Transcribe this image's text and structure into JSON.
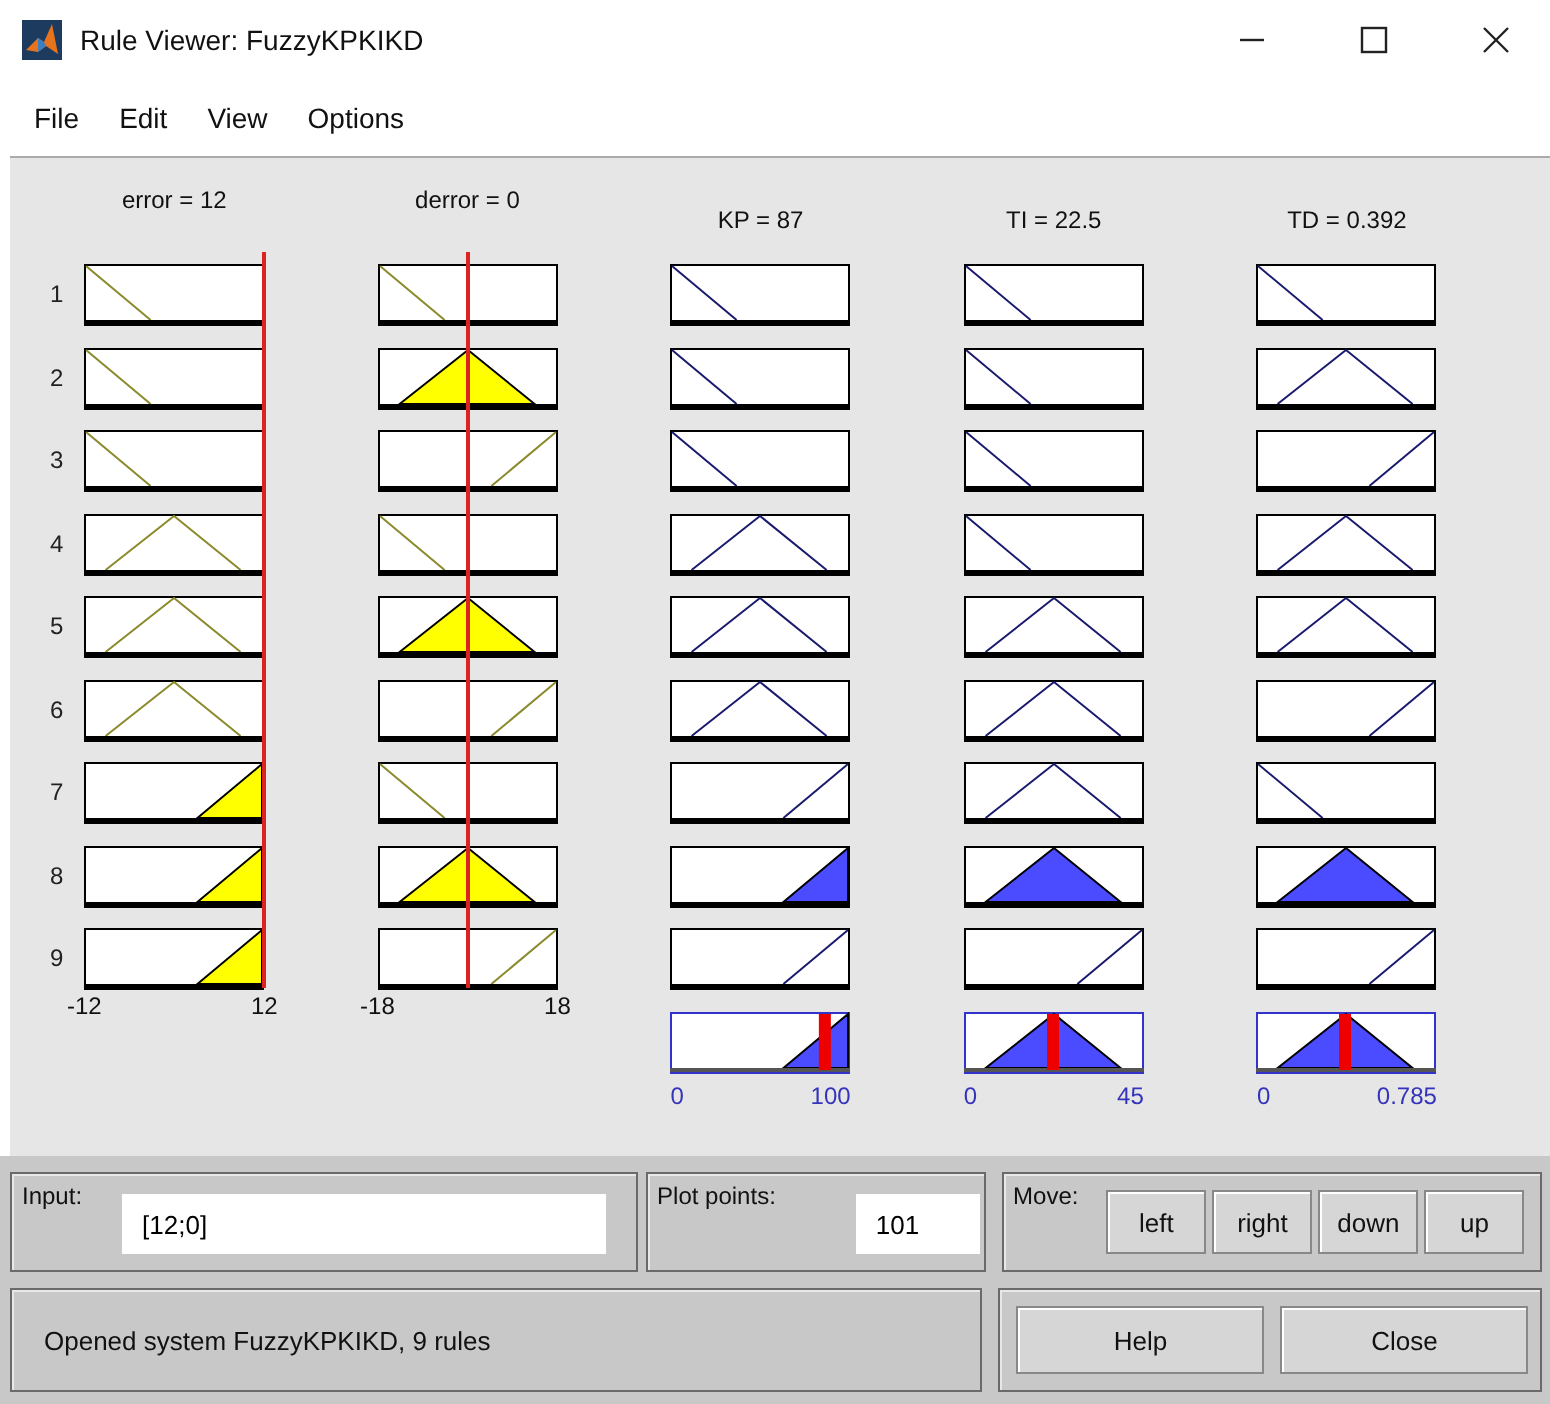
{
  "window": {
    "title": "Rule Viewer: FuzzyKPKIKD"
  },
  "menu": [
    "File",
    "Edit",
    "View",
    "Options"
  ],
  "rules": [
    "1",
    "2",
    "3",
    "4",
    "5",
    "6",
    "7",
    "8",
    "9"
  ],
  "variables": [
    {
      "kind": "input",
      "title": "error = 12",
      "min_label": "-12",
      "max_label": "12",
      "mfs": [
        {
          "kind": "low",
          "fired": false
        },
        {
          "kind": "low",
          "fired": false
        },
        {
          "kind": "low",
          "fired": false
        },
        {
          "kind": "mid",
          "fired": false
        },
        {
          "kind": "mid",
          "fired": false
        },
        {
          "kind": "mid",
          "fired": false
        },
        {
          "kind": "high",
          "fired": true
        },
        {
          "kind": "high",
          "fired": true
        },
        {
          "kind": "high",
          "fired": true
        }
      ]
    },
    {
      "kind": "input",
      "title": "derror = 0",
      "min_label": "-18",
      "max_label": "18",
      "mfs": [
        {
          "kind": "low",
          "fired": false
        },
        {
          "kind": "mid",
          "fired": true
        },
        {
          "kind": "high",
          "fired": false
        },
        {
          "kind": "low",
          "fired": false
        },
        {
          "kind": "mid",
          "fired": true
        },
        {
          "kind": "high",
          "fired": false
        },
        {
          "kind": "low",
          "fired": false
        },
        {
          "kind": "mid",
          "fired": true
        },
        {
          "kind": "high",
          "fired": false
        }
      ]
    },
    {
      "kind": "output",
      "title": "KP = 87",
      "min_label": "0",
      "max_label": "100",
      "aggregate": {
        "kind": "high"
      },
      "mfs": [
        {
          "kind": "low",
          "fired": false
        },
        {
          "kind": "low",
          "fired": false
        },
        {
          "kind": "low",
          "fired": false
        },
        {
          "kind": "mid",
          "fired": false
        },
        {
          "kind": "mid",
          "fired": false
        },
        {
          "kind": "mid",
          "fired": false
        },
        {
          "kind": "high",
          "fired": false
        },
        {
          "kind": "high",
          "fired": true
        },
        {
          "kind": "high",
          "fired": false
        }
      ]
    },
    {
      "kind": "output",
      "title": "TI = 22.5",
      "min_label": "0",
      "max_label": "45",
      "aggregate": {
        "kind": "mid"
      },
      "mfs": [
        {
          "kind": "low",
          "fired": false
        },
        {
          "kind": "low",
          "fired": false
        },
        {
          "kind": "low",
          "fired": false
        },
        {
          "kind": "low",
          "fired": false
        },
        {
          "kind": "mid",
          "fired": false
        },
        {
          "kind": "mid",
          "fired": false
        },
        {
          "kind": "mid",
          "fired": false
        },
        {
          "kind": "mid",
          "fired": true
        },
        {
          "kind": "high",
          "fired": false
        }
      ]
    },
    {
      "kind": "output",
      "title": "TD = 0.392",
      "min_label": "0",
      "max_label": "0.785",
      "aggregate": {
        "kind": "mid"
      },
      "mfs": [
        {
          "kind": "low",
          "fired": false
        },
        {
          "kind": "mid",
          "fired": false
        },
        {
          "kind": "high",
          "fired": false
        },
        {
          "kind": "mid",
          "fired": false
        },
        {
          "kind": "mid",
          "fired": false
        },
        {
          "kind": "high",
          "fired": false
        },
        {
          "kind": "low",
          "fired": false
        },
        {
          "kind": "mid",
          "fired": true
        },
        {
          "kind": "high",
          "fired": false
        }
      ]
    }
  ],
  "input": {
    "label": "Input:",
    "value": "[12;0]"
  },
  "plot_points": {
    "label": "Plot points:",
    "value": "101"
  },
  "move": {
    "label": "Move:",
    "buttons": [
      "left",
      "right",
      "down",
      "up"
    ]
  },
  "status": "Opened system FuzzyKPKIKD, 9 rules",
  "buttons": [
    "Help",
    "Close"
  ]
}
